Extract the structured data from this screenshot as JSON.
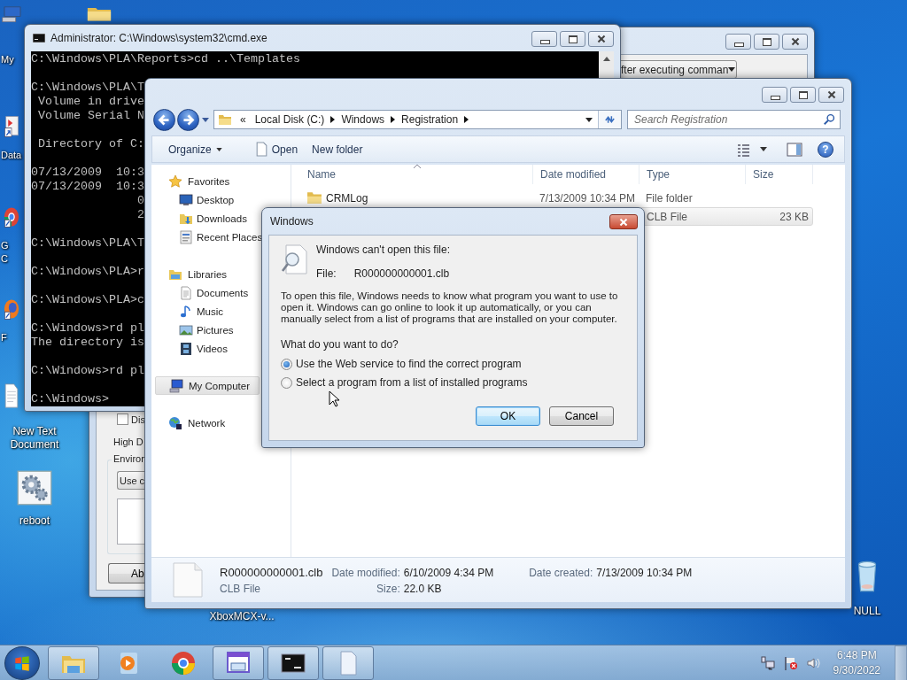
{
  "desktop_icons": [
    {
      "kind": "computer",
      "lines": [
        "My"
      ]
    },
    {
      "kind": "folder"
    },
    {
      "kind": "shortcut",
      "lines": [
        "Data"
      ]
    },
    {
      "kind": "browser",
      "lines": [
        "G",
        "C"
      ]
    },
    {
      "kind": "browser_orange",
      "lines": [
        "F"
      ]
    },
    {
      "kind": "text_file",
      "lines": [
        "New Text",
        "Document"
      ]
    },
    {
      "kind": "settings",
      "lines": [
        "reboot"
      ]
    },
    {
      "kind": "label_only",
      "lines": [
        "XboxMCX-v..."
      ]
    },
    {
      "kind": "recycle_bin",
      "lines": [
        "NULL"
      ]
    }
  ],
  "back_window": {
    "dropdown": "fter executing comman",
    "checkbox": {
      "label": "Dis",
      "checked": false
    },
    "label": "High D",
    "group": "Environ",
    "combo": "Use c",
    "button": "Ab"
  },
  "cmd": {
    "title": "Administrator: C:\\Windows\\system32\\cmd.exe",
    "blocks": [
      [
        "C:\\Windows\\PLA\\Reports>cd ..\\Templates"
      ],
      [
        "C:\\Windows\\PLA\\T",
        " Volume in drive",
        " Volume Serial N"
      ],
      [
        " Directory of C:"
      ],
      [
        "07/13/2009  10:3",
        "07/13/2009  10:3",
        "               0",
        "               2"
      ],
      [
        "C:\\Windows\\PLA\\T"
      ],
      [
        "C:\\Windows\\PLA>r"
      ],
      [
        "C:\\Windows\\PLA>c"
      ],
      [
        "C:\\Windows>rd pl",
        "The directory is"
      ],
      [
        "C:\\Windows>rd pl"
      ],
      [
        "C:\\Windows>"
      ]
    ]
  },
  "explorer": {
    "breadcrumb": {
      "overflow": "«",
      "parts": [
        "Local Disk (C:)",
        "Windows",
        "Registration"
      ]
    },
    "search": {
      "placeholder": "Search Registration"
    },
    "toolbar": {
      "organize": "Organize",
      "open": "Open",
      "new_folder": "New folder",
      "help": "?"
    },
    "nav": [
      {
        "label": "Favorites",
        "kind": "star",
        "selected": false,
        "children": [
          {
            "label": "Desktop",
            "kind": "desktop",
            "selected": false
          },
          {
            "label": "Downloads",
            "kind": "downloads",
            "selected": false
          },
          {
            "label": "Recent Places",
            "kind": "recent",
            "selected": false
          }
        ]
      },
      {
        "label": "Libraries",
        "kind": "library",
        "selected": false,
        "children": [
          {
            "label": "Documents",
            "kind": "documents",
            "selected": false
          },
          {
            "label": "Music",
            "kind": "music",
            "selected": false
          },
          {
            "label": "Pictures",
            "kind": "pictures",
            "selected": false
          },
          {
            "label": "Videos",
            "kind": "videos",
            "selected": false
          }
        ]
      },
      {
        "label": "My Computer",
        "kind": "computer",
        "selected": true
      },
      {
        "label": "Network",
        "kind": "network",
        "selected": false
      }
    ],
    "columns": [
      "Name",
      "Date modified",
      "Type",
      "Size"
    ],
    "rows": [
      {
        "name": "CRMLog",
        "date": "7/13/2009 10:34 PM",
        "type": "File folder",
        "selected": false
      },
      {
        "type": "CLB File",
        "size": "23 KB",
        "selected": true
      }
    ],
    "details": {
      "name": "R000000000001.clb",
      "type": "CLB File",
      "fields": [
        {
          "label": "Date modified:",
          "value": "6/10/2009 4:34 PM"
        },
        {
          "label": "Size:",
          "value": "22.0 KB"
        },
        {
          "label": "Date created:",
          "value": "7/13/2009 10:34 PM"
        }
      ]
    }
  },
  "dialog": {
    "title": "Windows",
    "heading": "Windows can't open this file:",
    "file_label": "File:",
    "file_name": "R000000000001.clb",
    "message": "To open this file, Windows needs to know what program you want to use to open it. Windows can go online to look it up automatically, or you can manually select from a list of programs that are installed on your computer.",
    "question": "What do you want to do?",
    "options": [
      {
        "label": "Use the Web service to find the correct program",
        "selected": true
      },
      {
        "label": "Select a program from a list of installed programs",
        "selected": false
      }
    ],
    "buttons": [
      {
        "label": "OK",
        "default": true
      },
      {
        "label": "Cancel",
        "default": false
      }
    ]
  },
  "taskbar": {
    "apps": [
      {
        "kind": "explorer",
        "running": true
      },
      {
        "kind": "media",
        "running": false
      },
      {
        "kind": "chrome",
        "running": false
      },
      {
        "kind": "window_app",
        "running": true
      },
      {
        "kind": "cmd",
        "running": true
      },
      {
        "kind": "document",
        "running": true
      }
    ],
    "clock": {
      "time": "6:48 PM",
      "date": "9/30/2022"
    }
  }
}
